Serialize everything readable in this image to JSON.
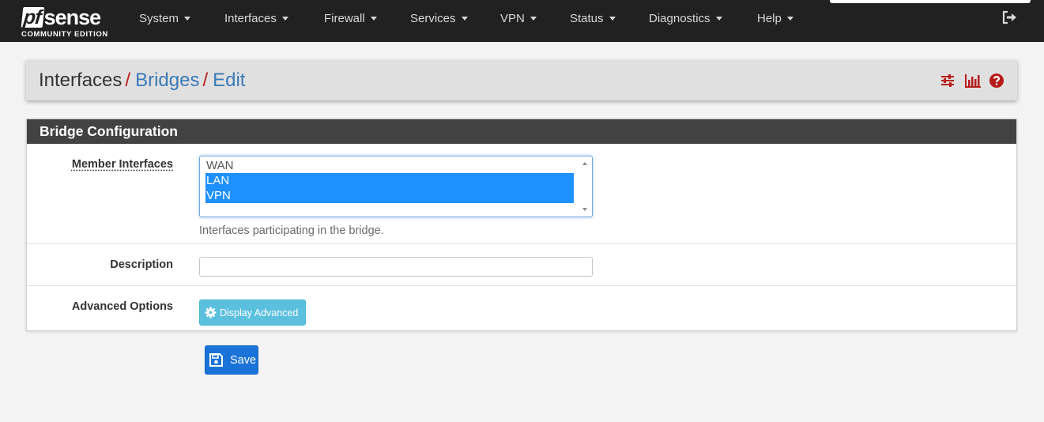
{
  "brand": {
    "logo_pf": "pf",
    "logo_sense": "sense",
    "edition": "COMMUNITY EDITION"
  },
  "nav": {
    "items": [
      {
        "label": "System"
      },
      {
        "label": "Interfaces"
      },
      {
        "label": "Firewall"
      },
      {
        "label": "Services"
      },
      {
        "label": "VPN"
      },
      {
        "label": "Status"
      },
      {
        "label": "Diagnostics"
      },
      {
        "label": "Help"
      }
    ],
    "logout_icon": "sign-out-icon"
  },
  "breadcrumb": {
    "items": [
      "Interfaces",
      "Bridges",
      "Edit"
    ],
    "separator": "/",
    "icons": [
      "sliders-icon",
      "bar-chart-icon",
      "question-circle-icon"
    ]
  },
  "panel": {
    "title": "Bridge Configuration",
    "member_interfaces": {
      "label": "Member Interfaces",
      "options": [
        {
          "label": "WAN",
          "selected": false
        },
        {
          "label": "LAN",
          "selected": true
        },
        {
          "label": "VPN",
          "selected": true
        }
      ],
      "help": "Interfaces participating in the bridge."
    },
    "description": {
      "label": "Description",
      "value": ""
    },
    "advanced": {
      "label": "Advanced Options",
      "button_label": "Display Advanced",
      "button_icon": "gear-icon"
    }
  },
  "save": {
    "label": "Save",
    "icon": "floppy-disk-icon"
  },
  "colors": {
    "navbar": "#212121",
    "breadcrumb_separator": "#b71c1c",
    "breadcrumb_link": "#3a7ab8",
    "panel_heading": "#424242",
    "selected_option": "#1e90ff",
    "info_button": "#5bc0de",
    "save_button": "#1a73d8"
  }
}
